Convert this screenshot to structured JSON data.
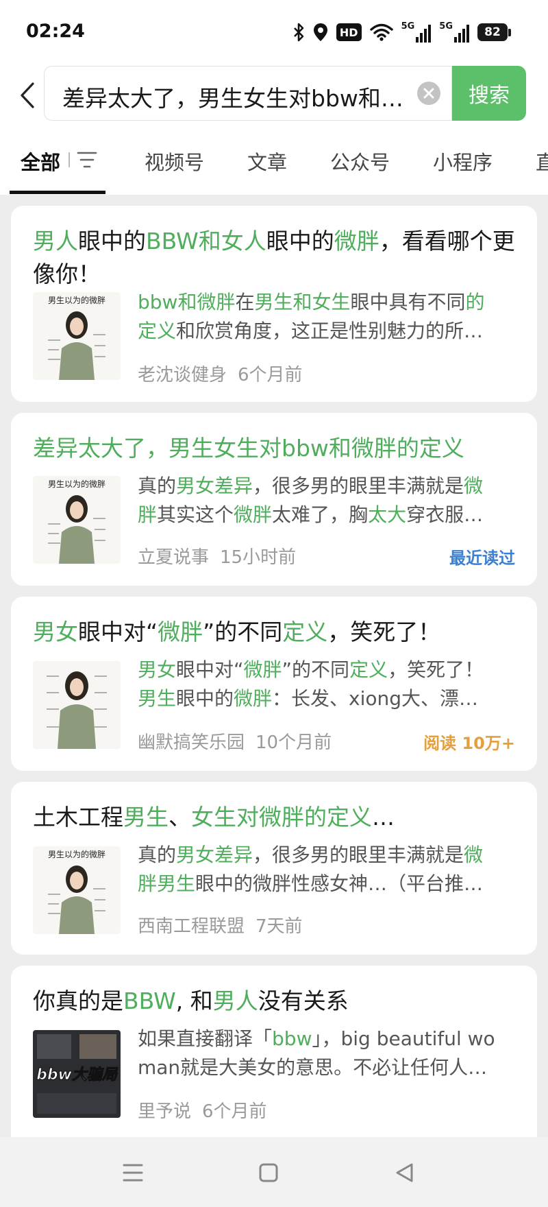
{
  "status_bar": {
    "time": "02:24",
    "hd_label": "HD",
    "net1_label": "5G",
    "net2_label": "5G",
    "battery_level": "82"
  },
  "search": {
    "query": "差异太大了，男生女生对bbw和…",
    "button_label": "搜索"
  },
  "tabs": [
    {
      "label": "全部",
      "active": true
    },
    {
      "label": "视频号"
    },
    {
      "label": "文章"
    },
    {
      "label": "公众号"
    },
    {
      "label": "小程序"
    },
    {
      "label": "直"
    }
  ],
  "results": [
    {
      "title": {
        "p1": "男人",
        "p2": "眼中的",
        "p3": "BBW和女人",
        "p4": "眼中的",
        "p5": "微胖",
        "p6": "，看看哪个更像你！"
      },
      "thumb_text": "男生以为的微胖",
      "desc": {
        "p1": "bbw和微胖",
        "p2": "在",
        "p3": "男生和女生",
        "p4": "眼中具有不同",
        "p5": "的",
        "p6": "定义",
        "p7": "和欣赏角度，这正是性别魅力的所…"
      },
      "author": "老沈谈健身",
      "time": "6个月前"
    },
    {
      "title": {
        "p1": "差异太大了，男生女生对bbw和微胖的定义"
      },
      "thumb_text": "男生以为的微胖",
      "desc": {
        "p1": "真的",
        "p2": "男女差异",
        "p3": "，很多男的眼里丰满就是",
        "p4": "微",
        "p5": "胖",
        "p6": "其实这个",
        "p7": "微胖",
        "p8": "太难了，胸",
        "p9": "太大",
        "p10": "穿衣服…"
      },
      "author": "立夏说事",
      "time": "15小时前",
      "tag": "最近读过",
      "tag_color": "#3d7fd0"
    },
    {
      "title": {
        "p1": "男女",
        "p2": "眼中对“",
        "p3": "微胖",
        "p4": "”的不同",
        "p5": "定义",
        "p6": "，笑死了！"
      },
      "thumb_text": "",
      "desc": {
        "p1": "男女",
        "p2": "眼中对“",
        "p3": "微胖",
        "p4": "”的不同",
        "p5": "定义",
        "p6": "，笑死了！",
        "p7": "男生",
        "p8": "眼中的",
        "p9": "微胖",
        "p10": "：长发、xiong大、漂…"
      },
      "author": "幽默搞笑乐园",
      "time": "10个月前",
      "tag": "阅读 10万+",
      "tag_color": "#e4a03c"
    },
    {
      "title": {
        "p1": "土木工程",
        "p2": "男生",
        "p3": "、",
        "p4": "女生对微胖的定义",
        "p5": "…"
      },
      "thumb_text": "男生以为的微胖",
      "desc": {
        "p1": "真的",
        "p2": "男女差异",
        "p3": "，很多男的眼里丰满就是",
        "p4": "微",
        "p5": "胖男生",
        "p6": "眼中的微胖性感女神…（平台推…"
      },
      "author": "西南工程联盟",
      "time": "7天前"
    },
    {
      "title": {
        "p1": "你真的是",
        "p2": "BBW",
        "p3": ", 和",
        "p4": "男人",
        "p5": "没有关系"
      },
      "thumb_text": "bbw大骗局",
      "desc": {
        "p1": "如果直接翻译「",
        "p2": "bbw",
        "p3": "」，big beautiful wo",
        "p4": "man就是大美女的意思。不必让任何人…"
      },
      "author": "里予说",
      "time": "6个月前"
    }
  ],
  "colors": {
    "accent_green": "#5cc06a",
    "highlight_green": "#4fae5c",
    "recent_read_blue": "#3d7fd0",
    "reads_orange": "#e4a03c"
  },
  "icons": {
    "back": "chevron-left-icon",
    "clear": "clear-circle-icon",
    "filter": "filter-icon",
    "nav_menu": "menu-icon",
    "nav_home": "home-square-icon",
    "nav_back": "back-triangle-icon"
  }
}
